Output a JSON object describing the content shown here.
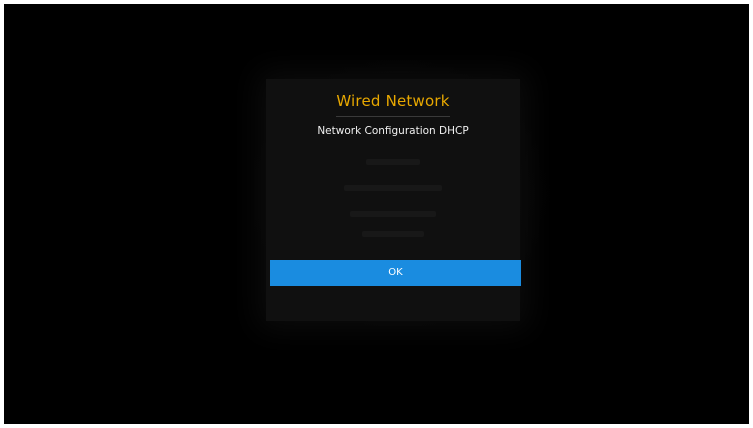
{
  "dialog": {
    "title": "Wired Network",
    "subtitle": "Network Configuration DHCP",
    "ok_label": "OK"
  },
  "colors": {
    "background": "#000000",
    "title": "#e8a800",
    "button": "#1a8ce0"
  }
}
